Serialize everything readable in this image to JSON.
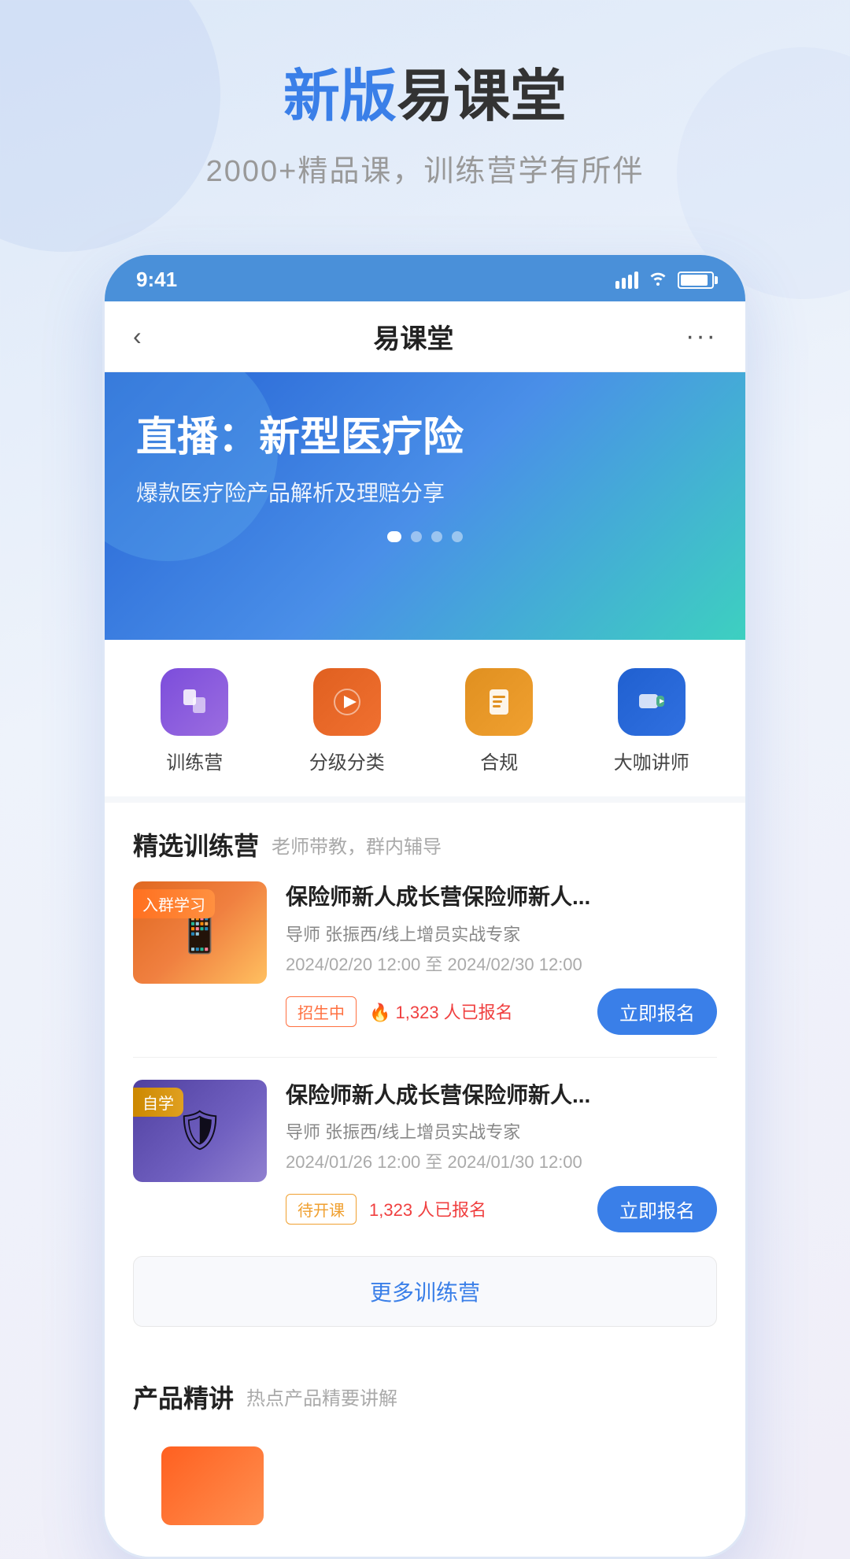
{
  "header": {
    "title_highlight": "新版",
    "title_rest": "易课堂",
    "subtitle": "2000+精品课，训练营学有所伴"
  },
  "status_bar": {
    "time": "9:41",
    "signal_alt": "signal bars",
    "wifi_alt": "wifi",
    "battery_alt": "battery"
  },
  "app_nav": {
    "back_icon": "‹",
    "title": "易课堂",
    "more_icon": "···"
  },
  "banner": {
    "title": "直播：新型医疗险",
    "subtitle": "爆款医疗险产品解析及理赔分享",
    "dots": [
      true,
      false,
      false,
      false
    ]
  },
  "quick_menu": {
    "items": [
      {
        "label": "训练营",
        "icon": "🎯",
        "icon_type": "purple"
      },
      {
        "label": "分级分类",
        "icon": "▶",
        "icon_type": "orange"
      },
      {
        "label": "合规",
        "icon": "📋",
        "icon_type": "amber"
      },
      {
        "label": "大咖讲师",
        "icon": "▶",
        "icon_type": "blue"
      }
    ]
  },
  "training_section": {
    "title": "精选训练营",
    "desc": "老师带教，群内辅导"
  },
  "courses": [
    {
      "badge": "入群学习",
      "badge_style": "orange",
      "name": "保险师新人成长营保险师新人...",
      "teacher": "导师 张振西/线上增员实战专家",
      "date": "2024/02/20 12:00 至 2024/02/30 12:00",
      "status_tag": "招生中",
      "status_style": "recruiting",
      "enrolled": "1,323 人已报名",
      "btn_label": "立即报名",
      "thumb_type": "warm"
    },
    {
      "badge": "自学",
      "badge_style": "yellow",
      "name": "保险师新人成长营保险师新人...",
      "teacher": "导师 张振西/线上增员实战专家",
      "date": "2024/01/26 12:00 至 2024/01/30 12:00",
      "status_tag": "待开课",
      "status_style": "pending",
      "enrolled": "1,323 人已报名",
      "btn_label": "立即报名",
      "thumb_type": "cool"
    }
  ],
  "more_training_btn": "更多训练营",
  "product_section": {
    "title": "产品精讲",
    "desc": "热点产品精要讲解"
  },
  "buttons": {
    "register": "立即报名",
    "more": "更多训练营"
  }
}
